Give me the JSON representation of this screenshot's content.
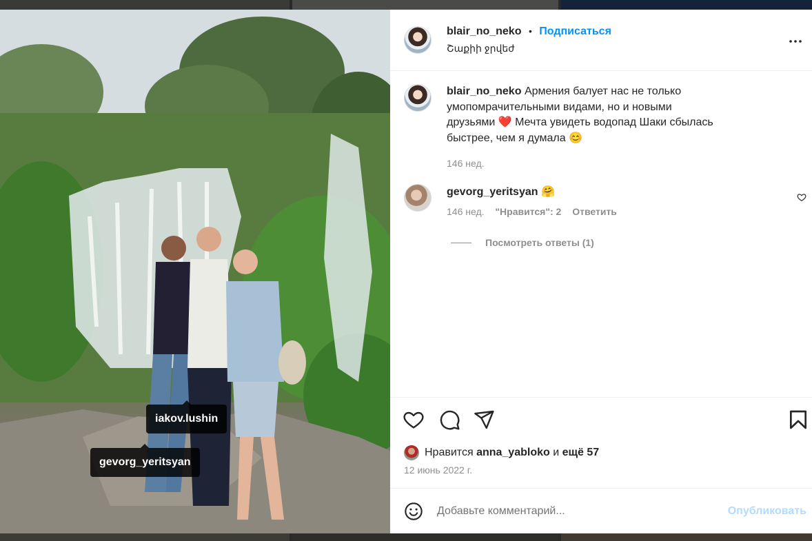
{
  "post": {
    "author": "blair_no_neko",
    "separator": "•",
    "follow_label": "Подписаться",
    "location": "Շաքիի ջրվեժ",
    "caption": "Армения балует нас не только умопомрачительными видами, но и новыми друзьями ❤️ Мечта увидеть водопад Шаки сбылась быстрее, чем я думала 😊",
    "caption_age": "146 нед.",
    "tags": [
      "iakov.lushin",
      "gevorg_yeritsyan"
    ]
  },
  "comment": {
    "author": "gevorg_yeritsyan",
    "text": "🤗",
    "age": "146 нед.",
    "likes_label": "\"Нравится\": 2",
    "reply_label": "Ответить",
    "view_replies": "Посмотреть ответы (1)"
  },
  "likes": {
    "prefix": "Нравится",
    "user": "anna_yabloko",
    "conjunction": "и",
    "others": "ещё 57"
  },
  "date": "12 июнь 2022 г.",
  "add_comment": {
    "placeholder": "Добавьте комментарий...",
    "publish_label": "Опубликовать"
  },
  "icons": {
    "more": "more-horizontal-icon",
    "like": "heart-icon",
    "comment": "comment-bubble-icon",
    "share": "paper-plane-icon",
    "save": "bookmark-icon",
    "emoji": "emoji-smile-icon"
  },
  "colors": {
    "accent": "#0095f6",
    "publish_disabled": "#b3dbff",
    "muted": "#8e8e8e"
  }
}
